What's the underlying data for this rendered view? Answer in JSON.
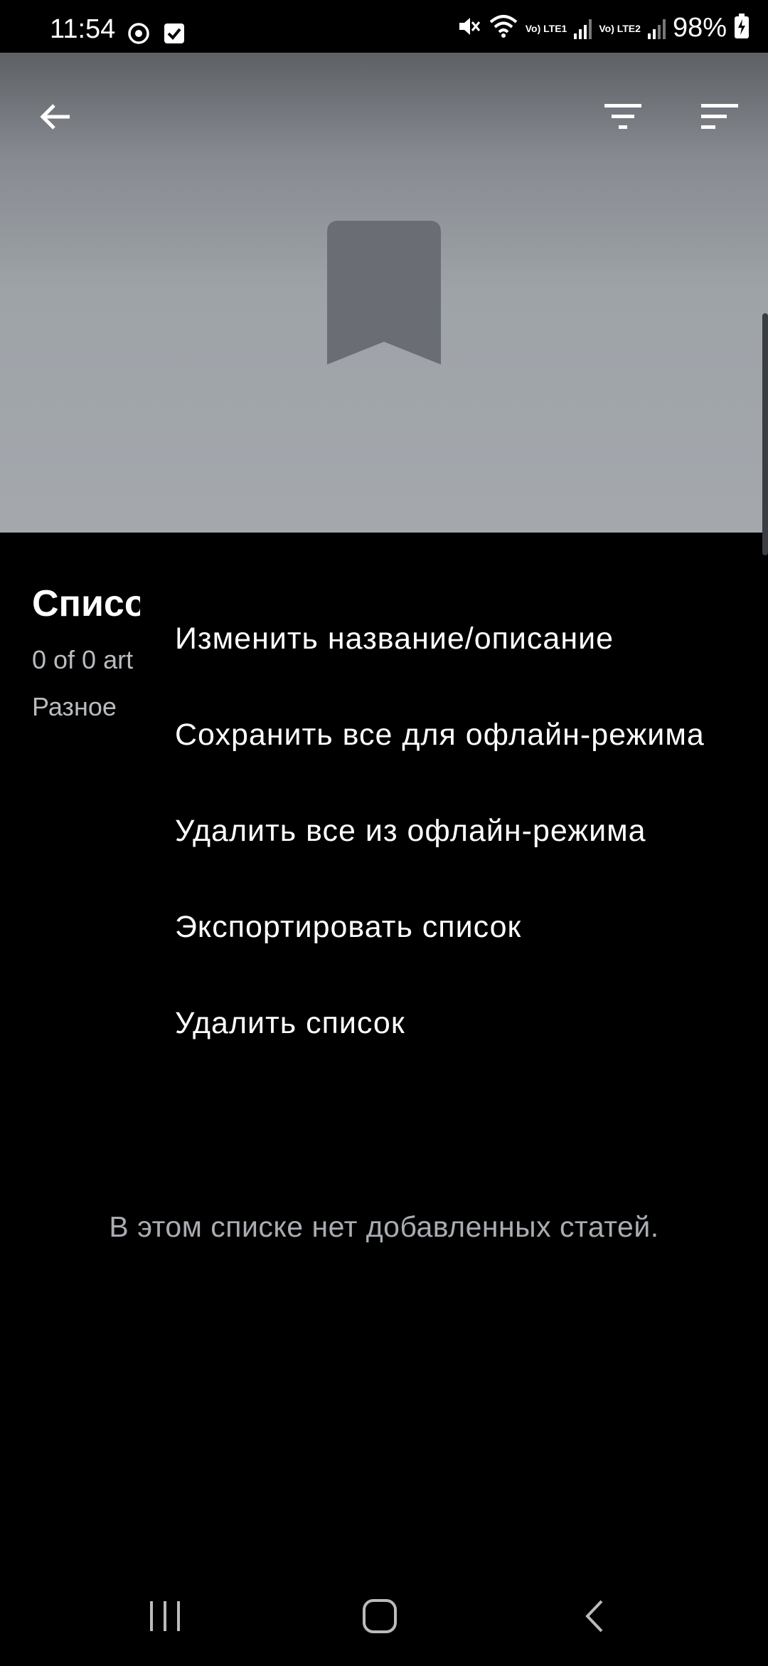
{
  "status_bar": {
    "time": "11:54",
    "battery_percent": "98%",
    "sim1_label": "Vo) LTE1",
    "sim2_label": "Vo) LTE2",
    "icons": [
      "sync-icon",
      "checkbox-icon",
      "mute-icon",
      "wifi-icon",
      "signal-icon",
      "battery-charging-icon"
    ]
  },
  "header": {
    "back_icon": "arrow-left-icon",
    "filter_icon": "filter-icon",
    "sort_icon": "sort-icon",
    "placeholder_icon": "bookmark-icon"
  },
  "list": {
    "title": "Списо",
    "count": "0 of 0 art",
    "category": "Разное"
  },
  "menu": {
    "items": [
      {
        "label": "Изменить название/описание"
      },
      {
        "label": "Сохранить все для офлайн-режима"
      },
      {
        "label": "Удалить все из офлайн-режима"
      },
      {
        "label": "Экспортировать список"
      },
      {
        "label": "Удалить список"
      }
    ]
  },
  "empty_message": "В этом списке нет добавленных статей.",
  "nav_bar": {
    "icons": [
      "recents-icon",
      "home-icon",
      "back-icon"
    ]
  },
  "colors": {
    "background": "#000000",
    "header_top": "#5d6166",
    "header_bottom": "#a4a8ad",
    "bookmark": "#6a6e74",
    "secondary_text": "#a9adb2"
  }
}
